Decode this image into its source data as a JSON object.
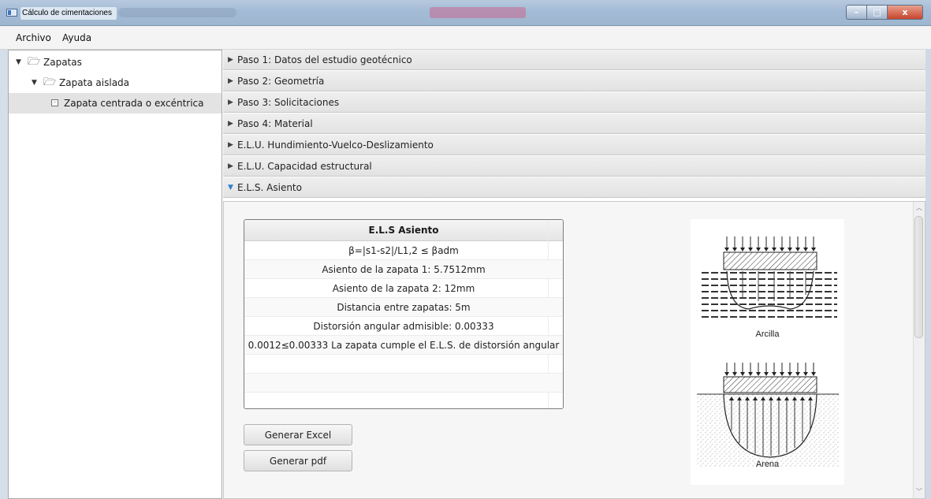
{
  "window": {
    "title": "Cálculo de cimentaciones",
    "buttons": {
      "minimize": "–",
      "maximize": "□",
      "close": "x"
    }
  },
  "menu": {
    "items": [
      "Archivo",
      "Ayuda"
    ]
  },
  "tree": [
    {
      "label": "Zapatas",
      "level": 0,
      "expanded": true,
      "type": "folder"
    },
    {
      "label": "Zapata aislada",
      "level": 1,
      "expanded": true,
      "type": "folder"
    },
    {
      "label": "Zapata centrada o excéntrica",
      "level": 2,
      "type": "leaf",
      "selected": true
    }
  ],
  "accordion": [
    {
      "label": "Paso 1: Datos del estudio geotécnico",
      "expanded": false
    },
    {
      "label": "Paso 2: Geometría",
      "expanded": false
    },
    {
      "label": "Paso 3: Solicitaciones",
      "expanded": false
    },
    {
      "label": "Paso 4: Material",
      "expanded": false
    },
    {
      "label": "E.L.U. Hundimiento-Vuelco-Deslizamiento",
      "expanded": false
    },
    {
      "label": "E.L.U. Capacidad estructural",
      "expanded": false
    },
    {
      "label": "E.L.S. Asiento",
      "expanded": true
    }
  ],
  "table": {
    "header": "E.L.S Asiento",
    "rows": [
      "β=|s1-s2|/L1,2 ≤ βadm",
      "Asiento de la zapata 1: 5.7512mm",
      "Asiento de la zapata 2: 12mm",
      "Distancia entre zapatas: 5m",
      "Distorsión angular admisible: 0.00333",
      "0.0012≤0.00333 La zapata cumple el E.L.S. de distorsión angular",
      "",
      "",
      ""
    ]
  },
  "buttons": {
    "excel": "Generar Excel",
    "pdf": "Generar pdf"
  },
  "figure": {
    "label_top": "Arcilla",
    "label_bottom": "Arena"
  }
}
